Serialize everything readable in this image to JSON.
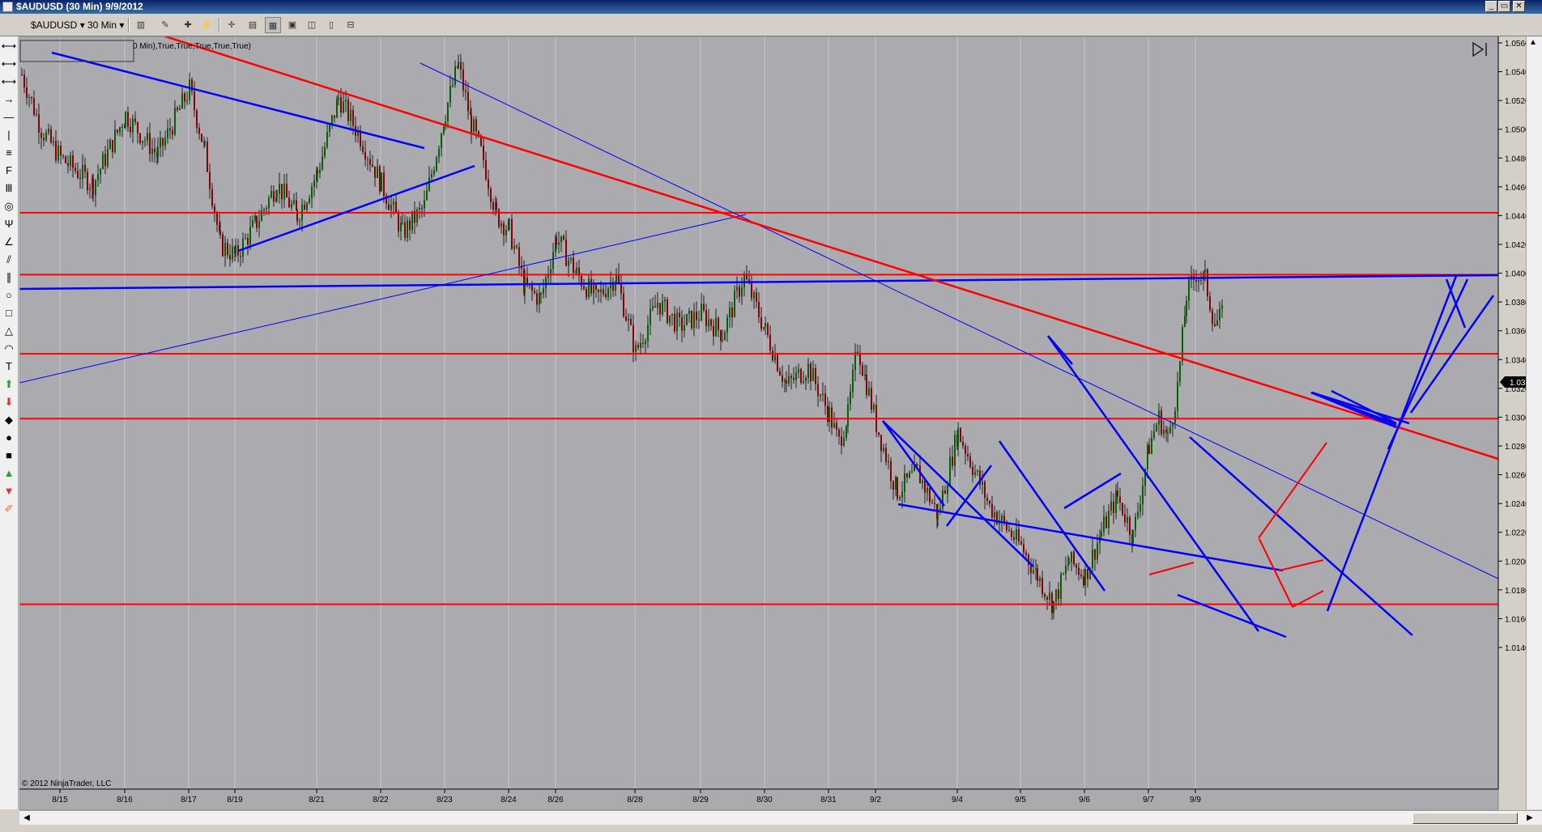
{
  "window": {
    "title": "$AUDUSD (30 Min)  9/9/2012"
  },
  "toolbar": {
    "instrument": "$AUDUSD",
    "interval": "30 Min"
  },
  "chart": {
    "params_text": "0 Min),True,True,True,True,True)",
    "copyright": "© 2012 NinjaTrader, LLC",
    "last_price": "1.0371",
    "price_labels": [
      "1.0560",
      "1.0540",
      "1.0520",
      "1.0500",
      "1.0480",
      "1.0460",
      "1.0440",
      "1.0420",
      "1.0400",
      "1.0380",
      "1.0360",
      "1.0340",
      "1.0320",
      "1.0300",
      "1.0280",
      "1.0260",
      "1.0240",
      "1.0220",
      "1.0200",
      "1.0180",
      "1.0160",
      "1.0140"
    ],
    "date_labels": [
      "8/15",
      "8/16",
      "8/17",
      "8/19",
      "8/21",
      "8/22",
      "8/23",
      "8/24",
      "8/26",
      "8/28",
      "8/29",
      "8/30",
      "8/31",
      "9/2",
      "9/4",
      "9/5",
      "9/6",
      "9/7",
      "9/9"
    ],
    "horizontal_levels": [
      1.0442,
      1.0399,
      1.0344,
      1.0299,
      1.017
    ],
    "colors": {
      "background": "#ababaf",
      "support_resistance": "#ff0000",
      "trendline": "#0000ff",
      "up_candle": "#006400",
      "down_candle": "#8b0000",
      "price_marker": "#000000"
    }
  },
  "chart_data": {
    "type": "candlestick",
    "instrument": "$AUDUSD",
    "timeframe": "30 Min",
    "ylim": [
      1.014,
      1.0565
    ],
    "close_path": [
      [
        "8/14",
        1.0538
      ],
      [
        "8/14",
        1.05
      ],
      [
        "8/15",
        1.048
      ],
      [
        "8/15",
        1.0462
      ],
      [
        "8/16",
        1.051
      ],
      [
        "8/16",
        1.0482
      ],
      [
        "8/17",
        1.0528
      ],
      [
        "8/17",
        1.0485
      ],
      [
        "8/17",
        1.042
      ],
      [
        "8/19",
        1.0412
      ],
      [
        "8/19",
        1.0435
      ],
      [
        "8/20",
        1.0462
      ],
      [
        "8/20",
        1.044
      ],
      [
        "8/21",
        1.047
      ],
      [
        "8/21",
        1.0522
      ],
      [
        "8/21",
        1.0495
      ],
      [
        "8/22",
        1.0462
      ],
      [
        "8/22",
        1.0428
      ],
      [
        "8/22",
        1.0446
      ],
      [
        "8/23",
        1.0512
      ],
      [
        "8/23",
        1.0545
      ],
      [
        "8/23",
        1.0505
      ],
      [
        "8/23",
        1.0478
      ],
      [
        "8/23",
        1.044
      ],
      [
        "8/24",
        1.043
      ],
      [
        "8/24",
        1.039
      ],
      [
        "8/24",
        1.0382
      ],
      [
        "8/26",
        1.0425
      ],
      [
        "8/26",
        1.04
      ],
      [
        "8/27",
        1.0382
      ],
      [
        "8/27",
        1.0398
      ],
      [
        "8/28",
        1.0345
      ],
      [
        "8/28",
        1.038
      ],
      [
        "8/28",
        1.0363
      ],
      [
        "8/29",
        1.0372
      ],
      [
        "8/29",
        1.0358
      ],
      [
        "8/29",
        1.0398
      ],
      [
        "8/30",
        1.036
      ],
      [
        "8/30",
        1.0322
      ],
      [
        "8/30",
        1.0335
      ],
      [
        "8/31",
        1.0302
      ],
      [
        "8/31",
        1.0282
      ],
      [
        "8/31",
        1.0302
      ],
      [
        "8/31",
        1.035
      ],
      [
        "8/31",
        1.0322
      ],
      [
        "9/2",
        1.0295
      ],
      [
        "9/2",
        1.0248
      ],
      [
        "9/3",
        1.0262
      ],
      [
        "9/3",
        1.0232
      ],
      [
        "9/4",
        1.029
      ],
      [
        "9/4",
        1.0238
      ],
      [
        "9/5",
        1.021
      ],
      [
        "9/5",
        1.019
      ],
      [
        "9/5",
        1.017
      ],
      [
        "9/5",
        1.02
      ],
      [
        "9/6",
        1.019
      ],
      [
        "9/6",
        1.022
      ],
      [
        "9/6",
        1.0245
      ],
      [
        "9/6",
        1.0218
      ],
      [
        "9/7",
        1.028
      ],
      [
        "9/7",
        1.03
      ],
      [
        "9/7",
        1.0285
      ],
      [
        "9/7",
        1.032
      ],
      [
        "9/7",
        1.0385
      ],
      [
        "9/9",
        1.04
      ],
      [
        "9/9",
        1.0395
      ],
      [
        "9/9",
        1.0365
      ],
      [
        "9/9",
        1.0371
      ]
    ],
    "last_price": 1.0371
  }
}
